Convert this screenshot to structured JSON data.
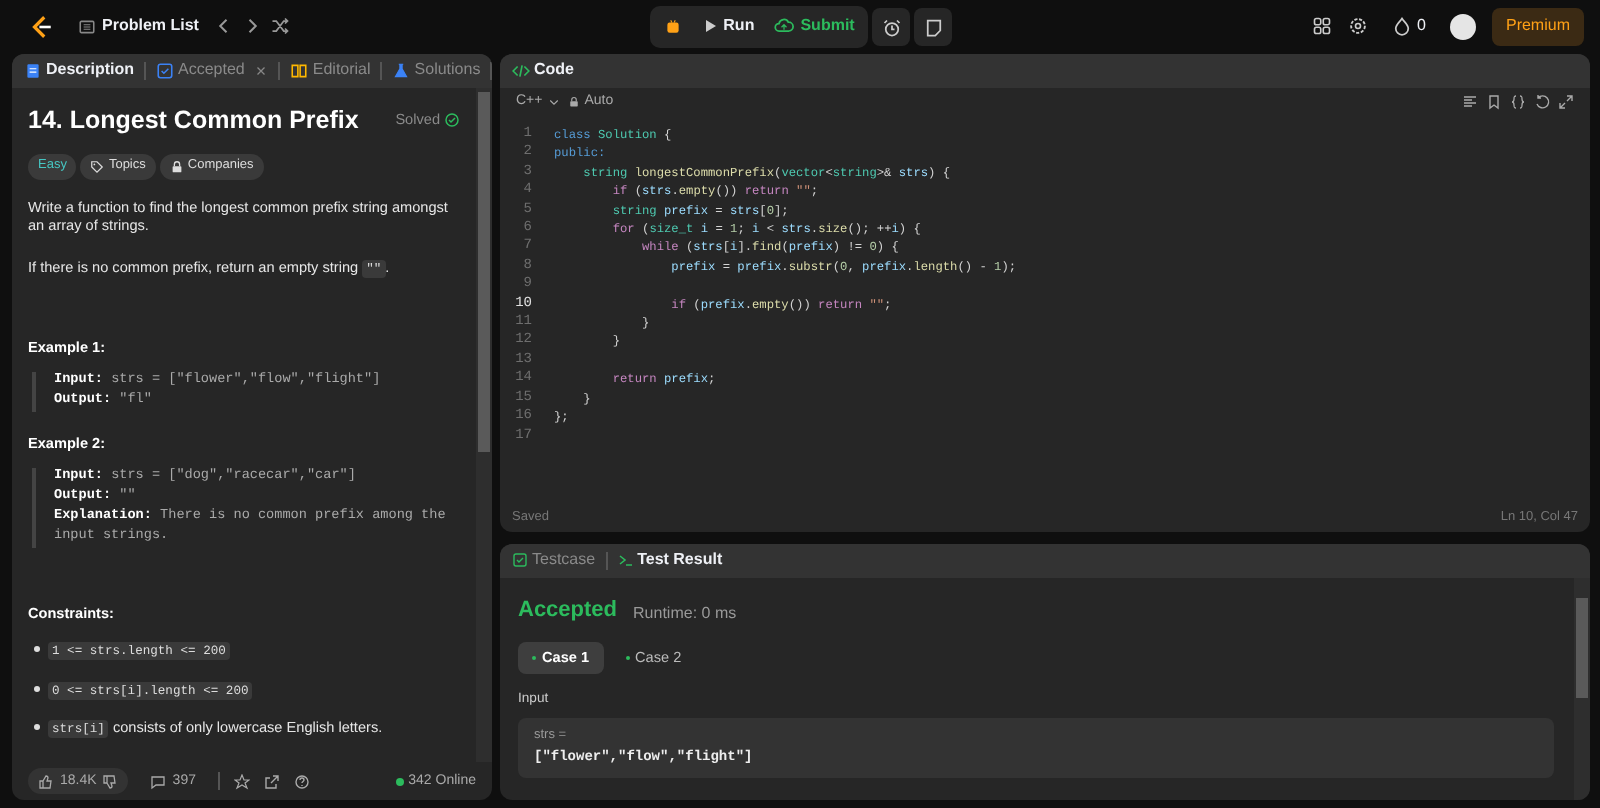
{
  "topbar": {
    "problem_list": "Problem List",
    "run": "Run",
    "submit": "Submit",
    "streak": "0",
    "premium": "Premium"
  },
  "description_tabs": [
    {
      "kind": "description",
      "label": "Description",
      "selected": true
    },
    {
      "kind": "accepted",
      "label": "Accepted",
      "selected": false
    },
    {
      "kind": "editorial",
      "label": "Editorial",
      "selected": false
    },
    {
      "kind": "solutions",
      "label": "Solutions",
      "selected": false
    }
  ],
  "problem": {
    "title": "14. Longest Common Prefix",
    "status": "Solved",
    "tags": [
      {
        "kind": "difficulty",
        "label": "Easy"
      },
      {
        "kind": "topics",
        "label": "Topics"
      },
      {
        "kind": "companies",
        "label": "Companies"
      }
    ],
    "paragraphs": [
      [
        {
          "kind": "text",
          "text": "Write a function to find the longest common prefix string amongst an array of strings."
        }
      ],
      [
        {
          "kind": "text",
          "text": "If there is no common prefix, return an empty string "
        },
        {
          "kind": "code",
          "text": "\"\""
        },
        {
          "kind": "text",
          "text": "."
        }
      ]
    ],
    "examples": [
      {
        "title": "Example 1:",
        "lines": [
          {
            "label": "Input:",
            "value": "strs = [\"flower\",\"flow\",\"flight\"]"
          },
          {
            "label": "Output:",
            "value": "\"fl\""
          }
        ]
      },
      {
        "title": "Example 2:",
        "lines": [
          {
            "label": "Input:",
            "value": "strs = [\"dog\",\"racecar\",\"car\"]"
          },
          {
            "label": "Output:",
            "value": "\"\""
          },
          {
            "label": "Explanation:",
            "value": "There is no common prefix among the input strings."
          }
        ]
      }
    ],
    "constraints_title": "Constraints:",
    "constraints": [
      [
        {
          "kind": "code",
          "text": "1 <= strs.length <= 200"
        }
      ],
      [
        {
          "kind": "code",
          "text": "0 <= strs[i].length <= 200"
        }
      ],
      [
        {
          "kind": "code",
          "text": "strs[i]"
        },
        {
          "kind": "text",
          "text": " consists of only lowercase English letters."
        }
      ]
    ]
  },
  "footer": {
    "likes": "18.4K",
    "comments": "397",
    "online": "342 Online"
  },
  "code_panel": {
    "title": "Code",
    "language": "C++",
    "mode": "Auto",
    "saved": "Saved",
    "cursor": "Ln 10, Col 47",
    "lines": [
      {
        "number": "1",
        "current": false,
        "tokens": [
          {
            "kind": "kw",
            "text": "class "
          },
          {
            "kind": "type",
            "text": "Solution"
          },
          {
            "kind": "p",
            "text": " {"
          }
        ]
      },
      {
        "number": "2",
        "current": false,
        "tokens": [
          {
            "kind": "kw",
            "text": "public:"
          }
        ]
      },
      {
        "number": "3",
        "current": false,
        "tokens": [
          {
            "kind": "type",
            "text": "    string "
          },
          {
            "kind": "fn",
            "text": "longestCommonPrefix"
          },
          {
            "kind": "p",
            "text": "("
          },
          {
            "kind": "type",
            "text": "vector"
          },
          {
            "kind": "p",
            "text": "<"
          },
          {
            "kind": "type",
            "text": "string"
          },
          {
            "kind": "p",
            "text": ">& "
          },
          {
            "kind": "var",
            "text": "strs"
          },
          {
            "kind": "p",
            "text": ") {"
          }
        ]
      },
      {
        "number": "4",
        "current": false,
        "tokens": [
          {
            "kind": "ctrl",
            "text": "        if"
          },
          {
            "kind": "p",
            "text": " ("
          },
          {
            "kind": "var",
            "text": "strs"
          },
          {
            "kind": "p",
            "text": "."
          },
          {
            "kind": "fn",
            "text": "empty"
          },
          {
            "kind": "p",
            "text": "()) "
          },
          {
            "kind": "ctrl",
            "text": "return "
          },
          {
            "kind": "str",
            "text": "\"\""
          },
          {
            "kind": "p",
            "text": ";"
          }
        ]
      },
      {
        "number": "5",
        "current": false,
        "tokens": [
          {
            "kind": "type",
            "text": "        string "
          },
          {
            "kind": "var",
            "text": "prefix"
          },
          {
            "kind": "p",
            "text": " = "
          },
          {
            "kind": "var",
            "text": "strs"
          },
          {
            "kind": "p",
            "text": "["
          },
          {
            "kind": "num",
            "text": "0"
          },
          {
            "kind": "p",
            "text": "];"
          }
        ]
      },
      {
        "number": "6",
        "current": false,
        "tokens": [
          {
            "kind": "ctrl",
            "text": "        for"
          },
          {
            "kind": "p",
            "text": " ("
          },
          {
            "kind": "type",
            "text": "size_t "
          },
          {
            "kind": "var",
            "text": "i"
          },
          {
            "kind": "p",
            "text": " = "
          },
          {
            "kind": "num",
            "text": "1"
          },
          {
            "kind": "p",
            "text": "; "
          },
          {
            "kind": "var",
            "text": "i"
          },
          {
            "kind": "p",
            "text": " < "
          },
          {
            "kind": "var",
            "text": "strs"
          },
          {
            "kind": "p",
            "text": "."
          },
          {
            "kind": "fn",
            "text": "size"
          },
          {
            "kind": "p",
            "text": "(); ++"
          },
          {
            "kind": "var",
            "text": "i"
          },
          {
            "kind": "p",
            "text": ") {"
          }
        ]
      },
      {
        "number": "7",
        "current": false,
        "tokens": [
          {
            "kind": "ctrl",
            "text": "            while"
          },
          {
            "kind": "p",
            "text": " ("
          },
          {
            "kind": "var",
            "text": "strs"
          },
          {
            "kind": "p",
            "text": "["
          },
          {
            "kind": "var",
            "text": "i"
          },
          {
            "kind": "p",
            "text": "]."
          },
          {
            "kind": "fn",
            "text": "find"
          },
          {
            "kind": "p",
            "text": "("
          },
          {
            "kind": "var",
            "text": "prefix"
          },
          {
            "kind": "p",
            "text": ") != "
          },
          {
            "kind": "num",
            "text": "0"
          },
          {
            "kind": "p",
            "text": ") {"
          }
        ]
      },
      {
        "number": "8",
        "current": false,
        "tokens": [
          {
            "kind": "var",
            "text": "                prefix"
          },
          {
            "kind": "p",
            "text": " = "
          },
          {
            "kind": "var",
            "text": "prefix"
          },
          {
            "kind": "p",
            "text": "."
          },
          {
            "kind": "fn",
            "text": "substr"
          },
          {
            "kind": "p",
            "text": "("
          },
          {
            "kind": "num",
            "text": "0"
          },
          {
            "kind": "p",
            "text": ", "
          },
          {
            "kind": "var",
            "text": "prefix"
          },
          {
            "kind": "p",
            "text": "."
          },
          {
            "kind": "fn",
            "text": "length"
          },
          {
            "kind": "p",
            "text": "() - "
          },
          {
            "kind": "num",
            "text": "1"
          },
          {
            "kind": "p",
            "text": ");"
          }
        ]
      },
      {
        "number": "9",
        "current": false
      },
      {
        "number": "10",
        "current": true,
        "tokens": [
          {
            "kind": "ctrl",
            "text": "                if"
          },
          {
            "kind": "p",
            "text": " ("
          },
          {
            "kind": "var",
            "text": "prefix"
          },
          {
            "kind": "p",
            "text": "."
          },
          {
            "kind": "fn",
            "text": "empty"
          },
          {
            "kind": "p",
            "text": "()) "
          },
          {
            "kind": "ctrl",
            "text": "return "
          },
          {
            "kind": "str",
            "text": "\"\""
          },
          {
            "kind": "p",
            "text": ";"
          }
        ]
      },
      {
        "number": "11",
        "current": false,
        "tokens": [
          {
            "kind": "p",
            "text": "            }"
          }
        ]
      },
      {
        "number": "12",
        "current": false,
        "tokens": [
          {
            "kind": "p",
            "text": "        }"
          }
        ]
      },
      {
        "number": "13",
        "current": false
      },
      {
        "number": "14",
        "current": false,
        "tokens": [
          {
            "kind": "ctrl",
            "text": "        return "
          },
          {
            "kind": "var",
            "text": "prefix"
          },
          {
            "kind": "p",
            "text": ";"
          }
        ]
      },
      {
        "number": "15",
        "current": false,
        "tokens": [
          {
            "kind": "p",
            "text": "    }"
          }
        ]
      },
      {
        "number": "16",
        "current": false,
        "tokens": [
          {
            "kind": "p",
            "text": "};"
          }
        ]
      },
      {
        "number": "17",
        "current": false
      }
    ]
  },
  "result_panel": {
    "tabs": [
      {
        "kind": "testcase",
        "label": "Testcase",
        "selected": false
      },
      {
        "kind": "result",
        "label": "Test Result",
        "selected": true
      }
    ],
    "verdict": "Accepted",
    "runtime": "Runtime: 0 ms",
    "cases": [
      {
        "label": "Case 1",
        "selected": true
      },
      {
        "label": "Case 2",
        "selected": false
      }
    ],
    "input_label": "Input",
    "param": "strs =",
    "value": "[\"flower\",\"flow\",\"flight\"]"
  }
}
